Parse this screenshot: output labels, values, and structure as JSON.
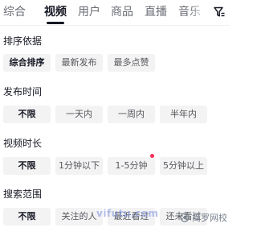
{
  "tabs": [
    {
      "label": "综合"
    },
    {
      "label": "视频"
    },
    {
      "label": "用户"
    },
    {
      "label": "商品"
    },
    {
      "label": "直播"
    },
    {
      "label": "音乐"
    }
  ],
  "active_tab": "视频",
  "filter_icon": "funnel-filter-icon",
  "sections": {
    "sort": {
      "title": "排序依据",
      "options": [
        {
          "label": "综合排序"
        },
        {
          "label": "最新发布"
        },
        {
          "label": "最多点赞"
        }
      ],
      "selected": "综合排序"
    },
    "publish_time": {
      "title": "发布时间",
      "options": [
        {
          "label": "不限"
        },
        {
          "label": "一天内"
        },
        {
          "label": "一周内"
        },
        {
          "label": "半年内"
        }
      ],
      "selected": "不限"
    },
    "duration": {
      "title": "视频时长",
      "options": [
        {
          "label": "不限"
        },
        {
          "label": "1分钟以下"
        },
        {
          "label": "1-5分钟"
        },
        {
          "label": "5分钟以上"
        }
      ],
      "selected": "不限",
      "badge_on": "1-5分钟"
    },
    "scope": {
      "title": "搜索范围",
      "options": [
        {
          "label": "不限"
        },
        {
          "label": "关注的人"
        },
        {
          "label": "最近看过"
        },
        {
          "label": "还未看过"
        }
      ],
      "selected": "不限"
    }
  },
  "watermark": "vifutu.com",
  "brand": {
    "label": "简罗网校",
    "icon": "brand-logo-icon"
  },
  "colors": {
    "accent_dot": "#fe2c55",
    "chip_bg": "#f3f3f4",
    "text": "#161823"
  }
}
